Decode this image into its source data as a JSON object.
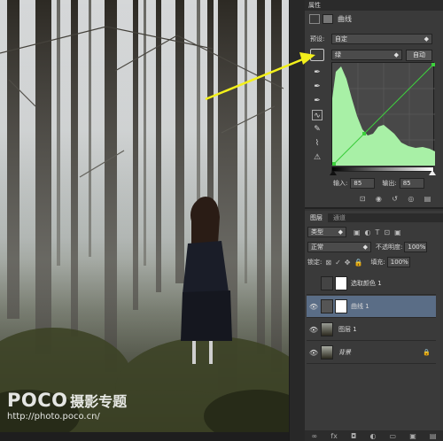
{
  "watermark": {
    "brand": "POCO",
    "brand_sub": "摄影专题",
    "url": "http://photo.poco.cn/"
  },
  "properties": {
    "tab": "属性",
    "title": "曲线",
    "preset_label": "预设:",
    "preset_value": "自定",
    "channel_value": "绿",
    "auto_button": "自动",
    "input_label": "输入:",
    "input_value": "85",
    "output_label": "输出:",
    "output_value": "85",
    "curve_color": "#3cd13c"
  },
  "layers_panel": {
    "tab_layers": "图层",
    "tab_channels": "通道",
    "kind": "类型",
    "blend_mode": "正常",
    "opacity_label": "不透明度:",
    "opacity_value": "100%",
    "lock_label": "锁定:",
    "fill_label": "填充:",
    "fill_value": "100%",
    "layers": [
      {
        "name": "选取颜色 1",
        "visible": false,
        "selected": false,
        "type": "adjustment"
      },
      {
        "name": "曲线 1",
        "visible": true,
        "selected": true,
        "type": "adjustment"
      },
      {
        "name": "图层 1",
        "visible": true,
        "selected": false,
        "type": "pixel"
      },
      {
        "name": "背景",
        "visible": true,
        "selected": false,
        "type": "background"
      }
    ]
  },
  "annotation": {
    "arrow_color": "#f3f01b"
  }
}
